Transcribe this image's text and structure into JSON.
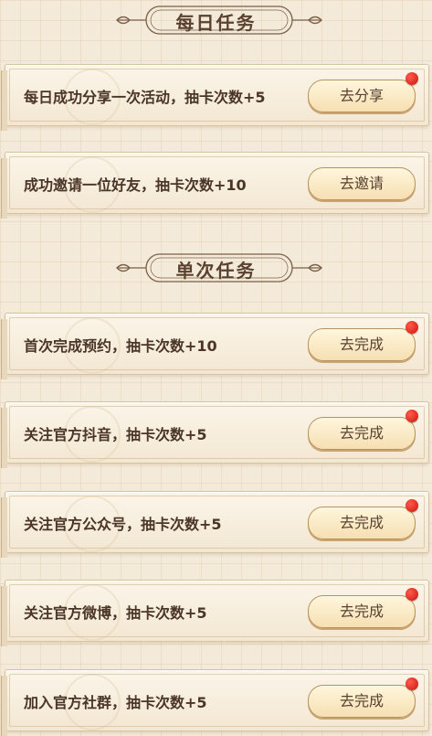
{
  "daily": {
    "title": "每日任务",
    "tasks": [
      {
        "text": "每日成功分享一次活动，抽卡次数+5",
        "button": "去分享",
        "badge": true
      },
      {
        "text": "成功邀请一位好友，抽卡次数+10",
        "button": "去邀请",
        "badge": false
      }
    ]
  },
  "once": {
    "title": "单次任务",
    "tasks": [
      {
        "text": "首次完成预约，抽卡次数+10",
        "button": "去完成",
        "badge": true
      },
      {
        "text": "关注官方抖音，抽卡次数+5",
        "button": "去完成",
        "badge": true
      },
      {
        "text": "关注官方公众号，抽卡次数+5",
        "button": "去完成",
        "badge": true
      },
      {
        "text": "关注官方微博，抽卡次数+5",
        "button": "去完成",
        "badge": true
      },
      {
        "text": "加入官方社群，抽卡次数+5",
        "button": "去完成",
        "badge": true
      }
    ]
  },
  "colors": {
    "accent": "#c9150e",
    "text": "#4a3526",
    "background": "#f4ead9"
  }
}
